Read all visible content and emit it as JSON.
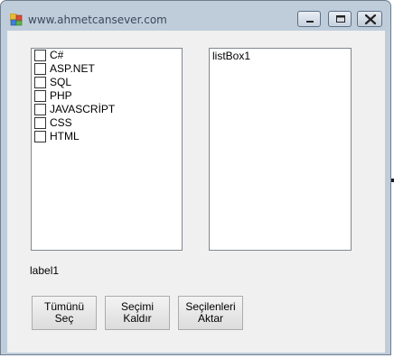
{
  "window": {
    "title": "www.ahmetcansever.com"
  },
  "checklist": {
    "items": [
      {
        "label": "C#",
        "checked": false
      },
      {
        "label": "ASP.NET",
        "checked": false
      },
      {
        "label": "SQL",
        "checked": false
      },
      {
        "label": "PHP",
        "checked": false
      },
      {
        "label": "JAVASCRİPT",
        "checked": false
      },
      {
        "label": "CSS",
        "checked": false
      },
      {
        "label": "HTML",
        "checked": false
      }
    ]
  },
  "listbox": {
    "items": [
      "listBox1"
    ]
  },
  "label1": "label1",
  "buttons": {
    "select_all": "Tümünü Seç",
    "clear_selection": "Seçimi Kaldır",
    "transfer_selected": "Seçilenleri Aktar"
  },
  "colors": {
    "frame": "#bfcddb",
    "client": "#f0f0f0",
    "close_button": "#c9d3de"
  }
}
